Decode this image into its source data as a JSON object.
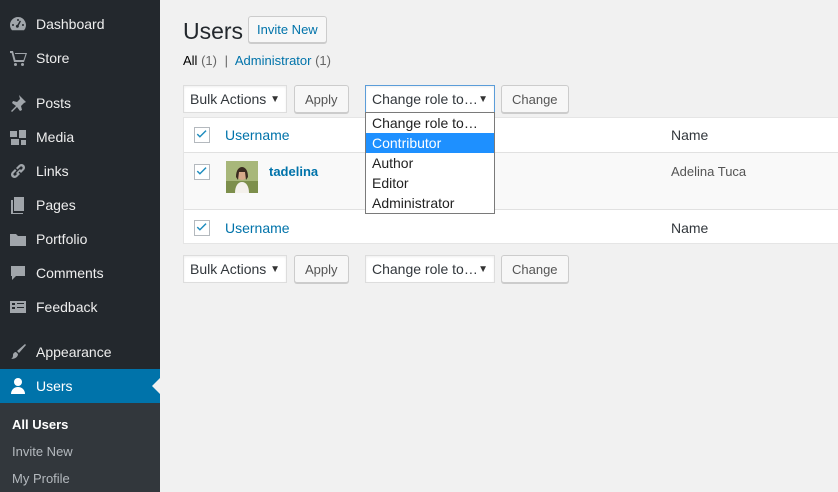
{
  "sidebar": {
    "items": [
      {
        "label": "Dashboard",
        "icon": "dashboard-icon"
      },
      {
        "label": "Store",
        "icon": "cart-icon"
      },
      {
        "label": "Posts",
        "icon": "pin-icon"
      },
      {
        "label": "Media",
        "icon": "media-icon"
      },
      {
        "label": "Links",
        "icon": "link-icon"
      },
      {
        "label": "Pages",
        "icon": "pages-icon"
      },
      {
        "label": "Portfolio",
        "icon": "folder-icon"
      },
      {
        "label": "Comments",
        "icon": "comment-icon"
      },
      {
        "label": "Feedback",
        "icon": "feedback-icon"
      },
      {
        "label": "Appearance",
        "icon": "brush-icon"
      },
      {
        "label": "Users",
        "icon": "user-icon",
        "active": true
      }
    ],
    "submenu": [
      "All Users",
      "Invite New",
      "My Profile"
    ]
  },
  "header": {
    "title": "Users",
    "invite_label": "Invite New"
  },
  "filters": {
    "all_label": "All",
    "all_count": "(1)",
    "separator": "|",
    "admin_label": "Administrator",
    "admin_count": "(1)"
  },
  "toolbar": {
    "bulk_actions": "Bulk Actions",
    "apply": "Apply",
    "change_role": "Change role to…",
    "change": "Change"
  },
  "role_dropdown": {
    "options": [
      "Change role to…",
      "Contributor",
      "Author",
      "Editor",
      "Administrator"
    ],
    "highlighted": "Contributor"
  },
  "table": {
    "columns": {
      "username": "Username",
      "name": "Name"
    },
    "rows": [
      {
        "username": "tadelina",
        "name": "Adelina Tuca",
        "checked": true
      }
    ]
  },
  "colors": {
    "sidebar_bg": "#23282d",
    "active_bg": "#0073aa",
    "link": "#0073aa",
    "highlight": "#1e90ff"
  }
}
